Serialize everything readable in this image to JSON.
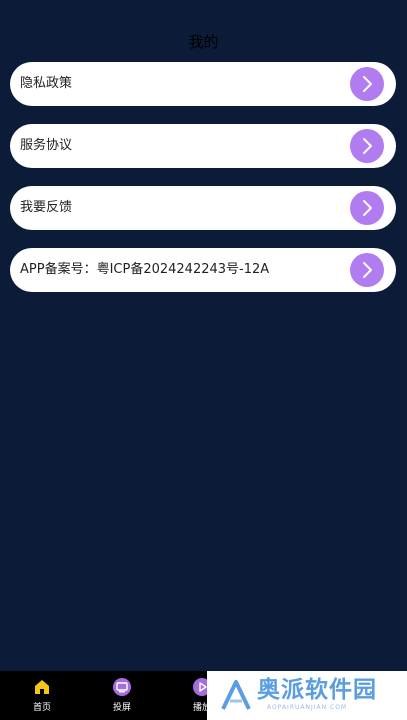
{
  "header": {
    "title": "我的"
  },
  "menu": [
    {
      "label": "隐私政策",
      "arrow_icon": "chevron-right-icon"
    },
    {
      "label": "服务协议",
      "arrow_icon": "chevron-right-icon"
    },
    {
      "label": "我要反馈",
      "arrow_icon": "chevron-right-icon"
    },
    {
      "label": "APP备案号：粤ICP备2024242243号-12A",
      "arrow_icon": "chevron-right-icon"
    }
  ],
  "tabbar": {
    "tabs": [
      {
        "label": "首页",
        "icon": "home-icon",
        "icon_color": "#f5c518"
      },
      {
        "label": "投屏",
        "icon": "cast-screen-icon",
        "icon_color": "#a46ee0"
      },
      {
        "label": "播放",
        "icon": "play-icon",
        "icon_color": "#a46ee0"
      }
    ]
  },
  "watermark": {
    "text": "奥派软件园",
    "subtext": "AOPAIRUANJIAN.COM"
  },
  "colors": {
    "background": "#0b1b38",
    "card": "#ffffff",
    "accent": "#b07cf0",
    "tabbar": "#000000"
  }
}
